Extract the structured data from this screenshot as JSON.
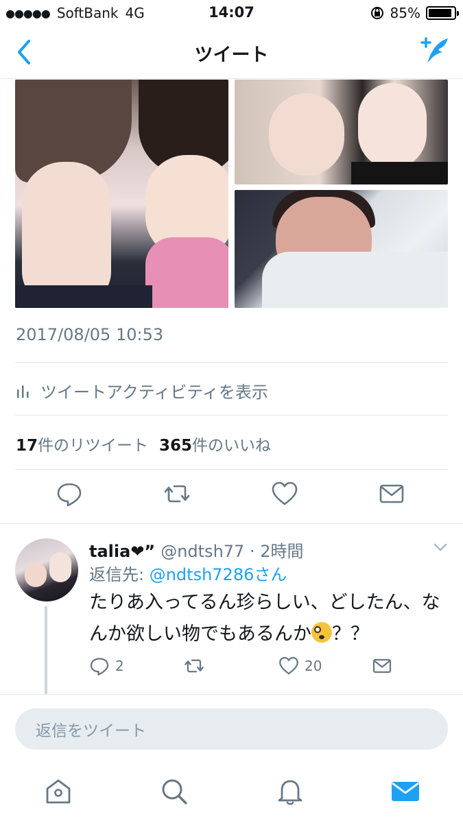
{
  "status_bar": {
    "signal": "●●●●●",
    "carrier": "SoftBank",
    "network": "4G",
    "time": "14:07",
    "battery": "85%"
  },
  "nav": {
    "title": "ツイート"
  },
  "tweet": {
    "timestamp": "2017/08/05 10:53",
    "activity_label": "ツイートアクティビティを表示",
    "retweets_count": "17",
    "retweets_label": "件のリツイート",
    "likes_count": "365",
    "likes_label": "件のいいね"
  },
  "reply": {
    "name": "talia❤”",
    "handle_time": "@ndtsh77 · 2時間",
    "reply_to_prefix": "返信先: ",
    "reply_to_user": "@ndtsh7286さん",
    "text_before_emoji": "たりあ入ってるん珍らしい、どしたん、なんか欲しい物でもあるんか",
    "text_after_emoji": "？？",
    "reply_count": "2",
    "like_count": "20"
  },
  "reply_input": {
    "placeholder": "返信をツイート"
  },
  "colors": {
    "accent": "#1da1f2",
    "secondary_text": "#657786",
    "divider": "#e1e8ed"
  },
  "icons": [
    "back-icon",
    "compose-icon",
    "reply-icon",
    "retweet-icon",
    "like-icon",
    "message-icon",
    "home-icon",
    "search-icon",
    "notifications-icon",
    "messages-icon",
    "chevron-down-icon",
    "stats-icon"
  ]
}
